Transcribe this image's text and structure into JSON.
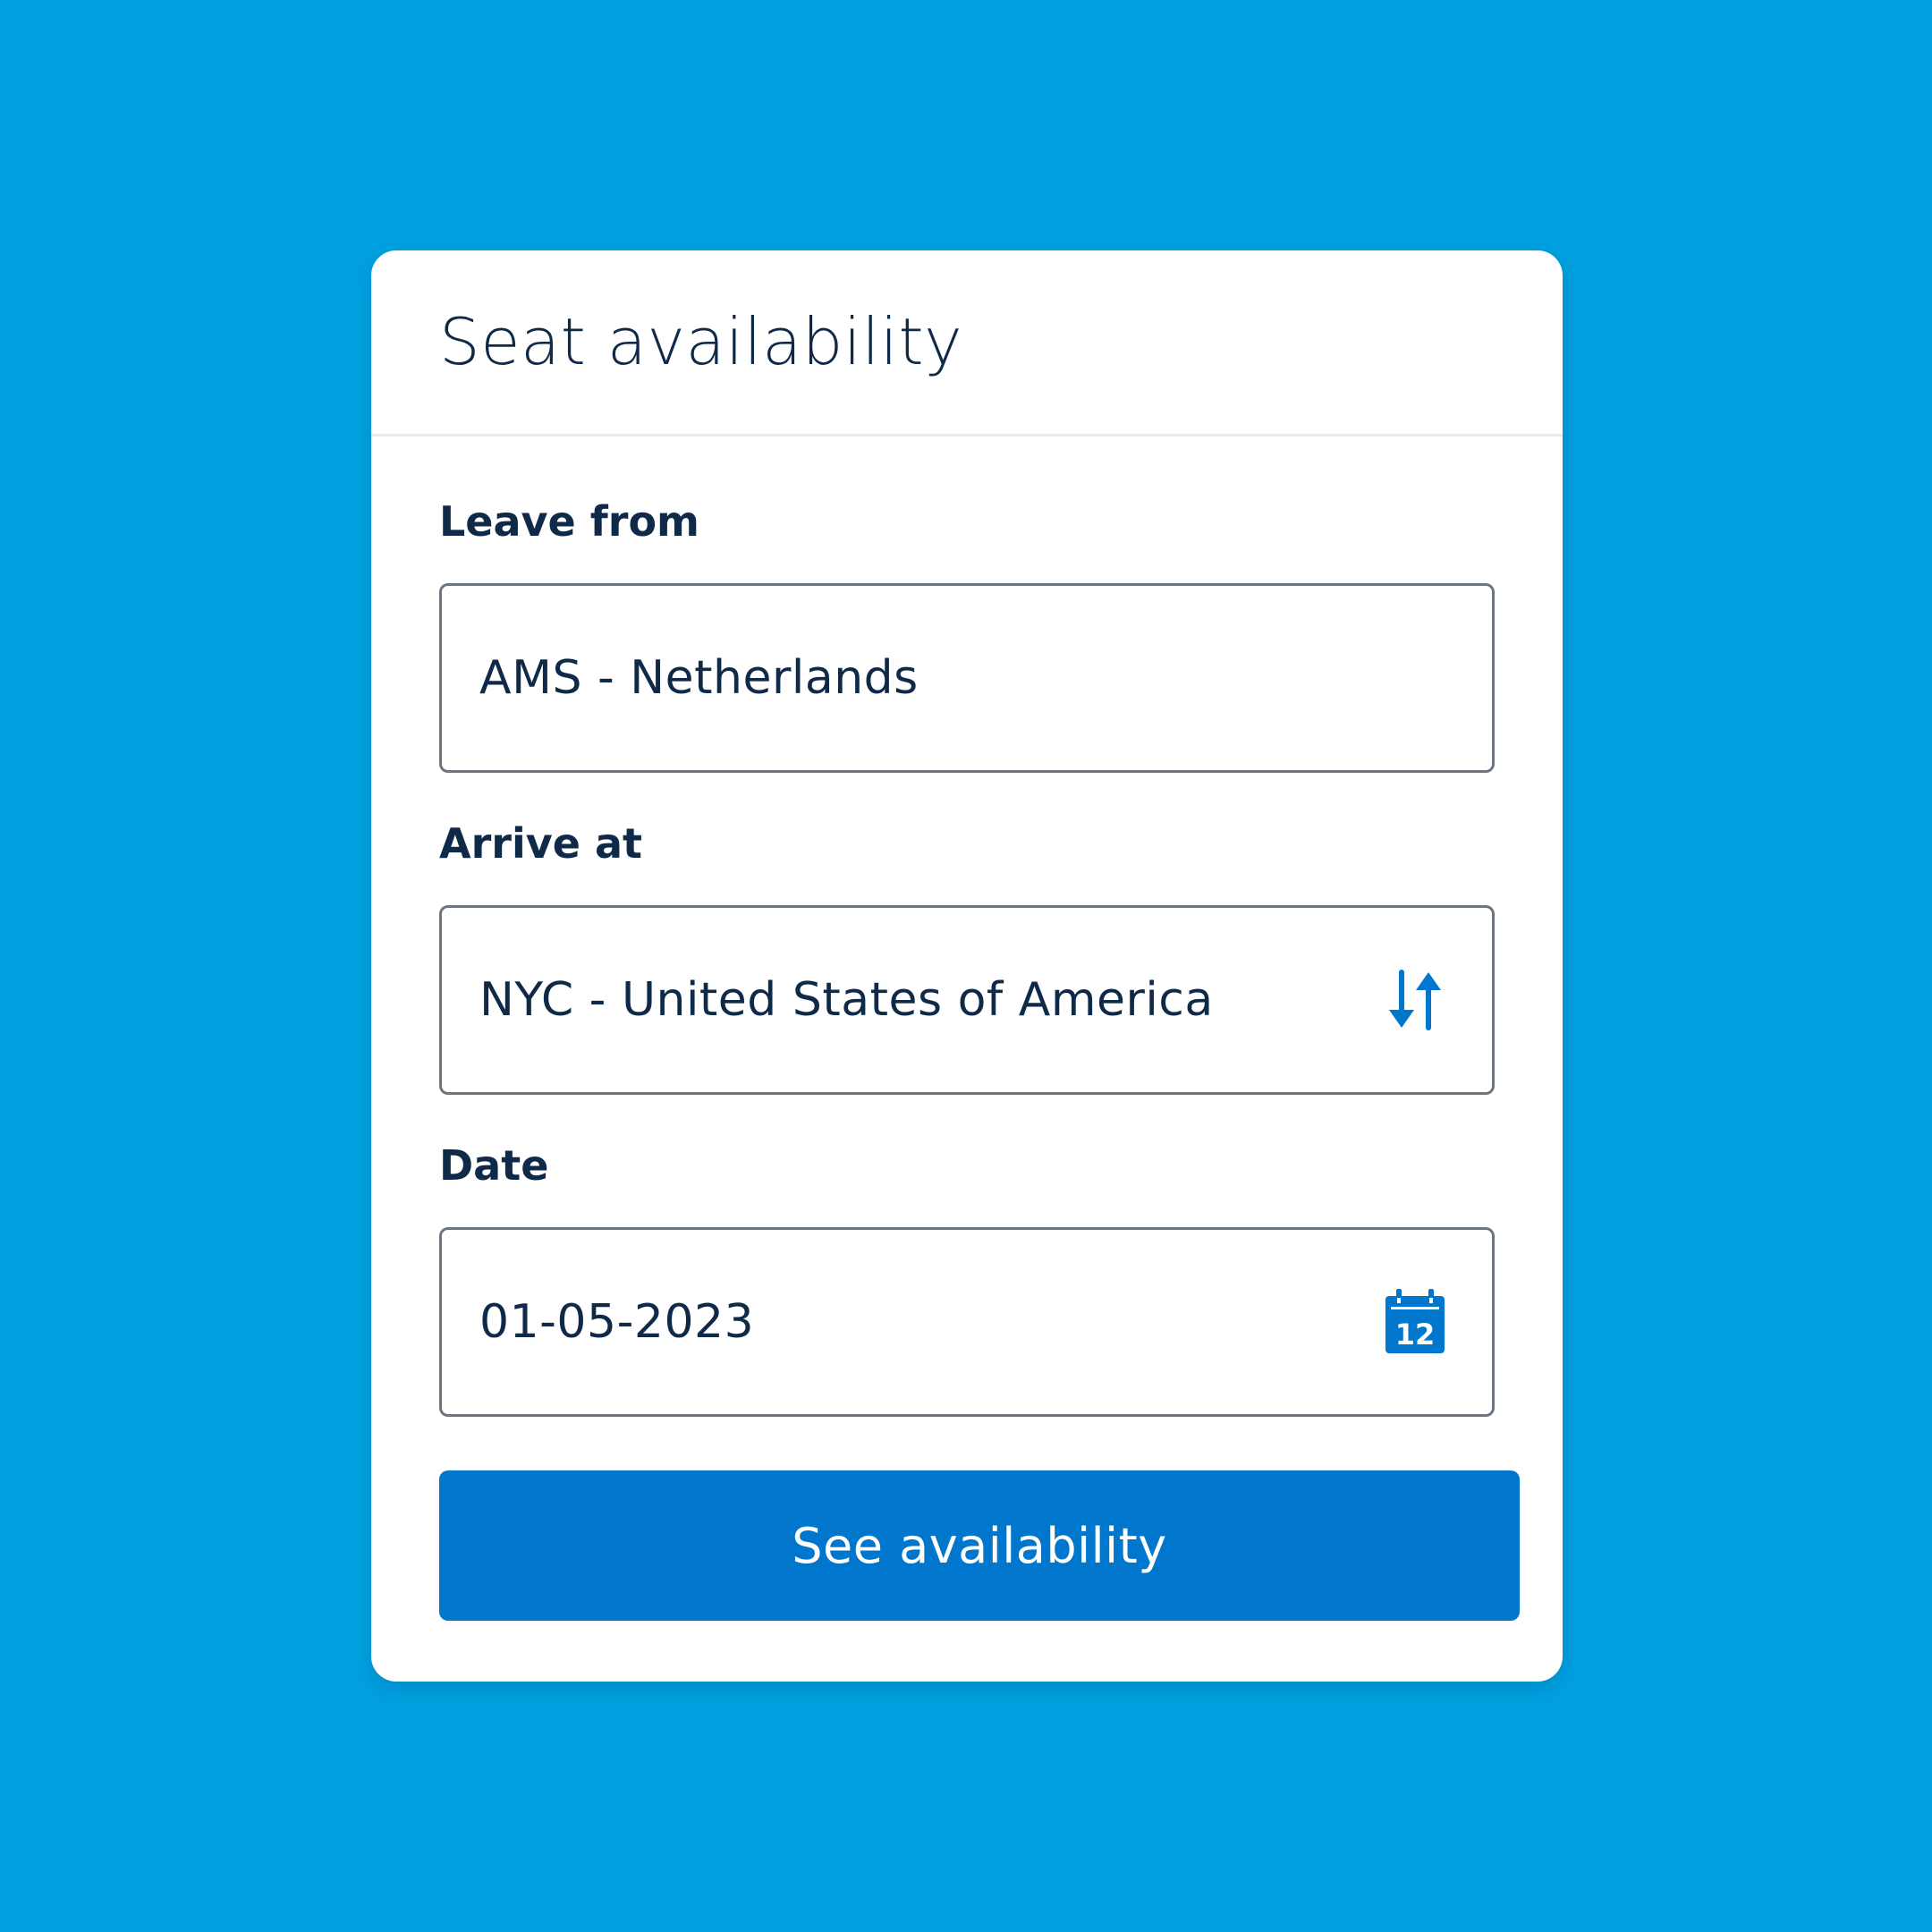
{
  "card": {
    "title": "Seat availability"
  },
  "form": {
    "leave_from": {
      "label": "Leave from",
      "value": "AMS - Netherlands"
    },
    "arrive_at": {
      "label": "Arrive at",
      "value": "NYC - United States of America",
      "icon": "swap-arrows-icon"
    },
    "date": {
      "label": "Date",
      "value": "01-05-2023",
      "icon": "calendar-icon",
      "icon_text": "12"
    },
    "submit_label": "See availability"
  },
  "colors": {
    "background": "#00a1e0",
    "accent": "#0076cc",
    "text": "#0f2a48",
    "border": "#6d7680"
  }
}
